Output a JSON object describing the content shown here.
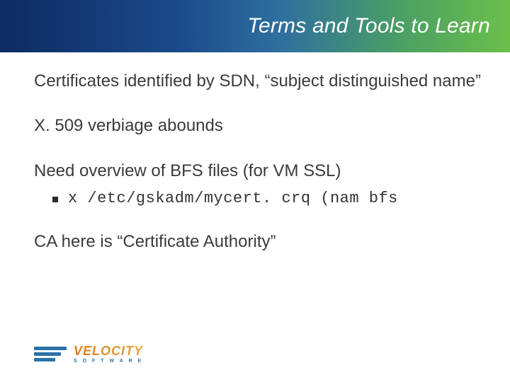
{
  "title": "Terms and Tools to Learn",
  "bullets": [
    "Certificates identified by SDN, “subject distinguished name”",
    "X. 509 verbiage abounds",
    "Need overview of BFS files (for VM SSL)",
    "CA here is “Certificate Authority”"
  ],
  "sub_code": "x /etc/gskadm/mycert. crq (nam bfs",
  "logo": {
    "main": "VELOCITY",
    "sub": "S O F T W A R E"
  }
}
